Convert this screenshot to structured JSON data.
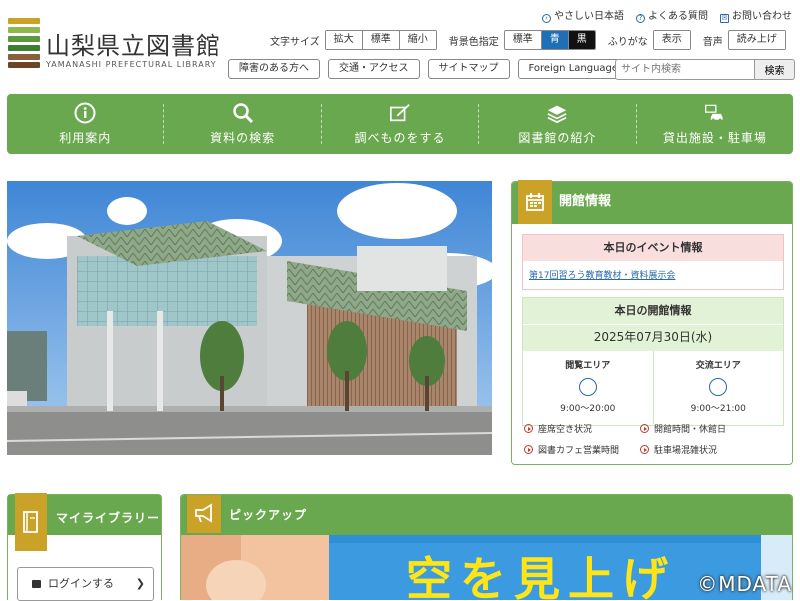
{
  "header": {
    "logo_title": "山梨県立図書館",
    "logo_sub": "YAMANASHI PREFECTURAL LIBRARY",
    "toplinks": [
      "やさしい日本語",
      "よくある質問",
      "お問い合わせ"
    ],
    "font_size_label": "文字サイズ",
    "font_size_buttons": [
      "拡大",
      "標準",
      "縮小"
    ],
    "bg_color_label": "背景色指定",
    "bg_color_buttons": [
      "標準",
      "青",
      "黒"
    ],
    "furigana_label": "ふりがな",
    "furigana_button": "表示",
    "voice_label": "音声",
    "voice_button": "読み上げ",
    "pill_links": [
      "障害のある方へ",
      "交通・アクセス",
      "サイトマップ",
      "Foreign Language"
    ],
    "search_placeholder": "サイト内検索",
    "search_button": "検索"
  },
  "nav": [
    {
      "label": "利用案内",
      "icon": "info-icon"
    },
    {
      "label": "資料の検索",
      "icon": "search-icon"
    },
    {
      "label": "調べものをする",
      "icon": "notebook-pen-icon"
    },
    {
      "label": "図書館の紹介",
      "icon": "books-icon"
    },
    {
      "label": "貸出施設・駐車場",
      "icon": "car-icon"
    }
  ],
  "info": {
    "title": "開館情報",
    "event_heading": "本日のイベント情報",
    "event_link": "第17回習ろう教育教材・資料展示会",
    "open_heading": "本日の開館情報",
    "date": "2025年07月30日(水)",
    "areas": [
      {
        "name": "閲覧エリア",
        "hours": "9:00〜20:00"
      },
      {
        "name": "交流エリア",
        "hours": "9:00〜21:00"
      }
    ],
    "links": [
      "座席空き状況",
      "開館時間・休館日",
      "図書カフェ営業時間",
      "駐車場混雑状況"
    ]
  },
  "mylibrary": {
    "title": "マイライブラリー",
    "login": "ログインする"
  },
  "pickup": {
    "title": "ピックアップ",
    "banner_text": "空を見上げ"
  },
  "watermark": "©MDATA",
  "colors": {
    "nav_green": "#6aa84f",
    "accent_gold": "#c9a227",
    "link_blue": "#2a6aa8",
    "bg_blue_button": "#1e6fb5",
    "bg_black_button": "#111111"
  }
}
